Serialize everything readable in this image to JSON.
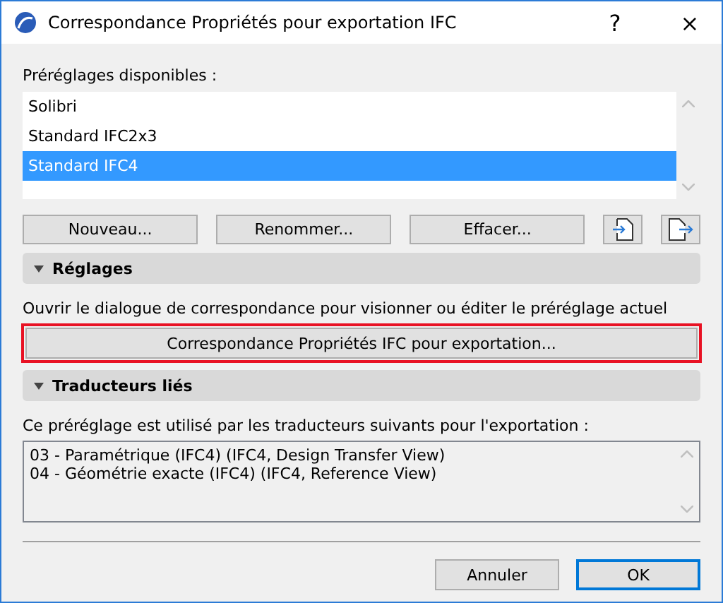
{
  "window": {
    "title": "Correspondance Propriétés pour exportation IFC",
    "help": "?",
    "close": "×"
  },
  "presets": {
    "label": "Préréglages disponibles :",
    "items": [
      {
        "label": "Solibri",
        "selected": false
      },
      {
        "label": "Standard IFC2x3",
        "selected": false
      },
      {
        "label": "Standard IFC4",
        "selected": true
      }
    ]
  },
  "preset_buttons": [
    "Nouveau...",
    "Renommer...",
    "Effacer..."
  ],
  "sections": [
    {
      "title": "Réglages",
      "expanded": true,
      "description": "Ouvrir le dialogue de correspondance pour visionner ou éditer le préréglage actuel",
      "button": {
        "label": "Correspondance Propriétés IFC pour exportation...",
        "highlighted": true
      }
    },
    {
      "title": "Traducteurs liés",
      "expanded": true,
      "description": "Ce préréglage est utilisé par les traducteurs suivants pour l'exportation :",
      "lines": [
        "03 - Paramétrique (IFC4) (IFC4, Design Transfer View)",
        "04 - Géométrie exacte (IFC4) (IFC4, Reference View)"
      ]
    }
  ],
  "footer_buttons": [
    {
      "label": "Annuler",
      "default": false
    },
    {
      "label": "OK",
      "default": true
    }
  ]
}
